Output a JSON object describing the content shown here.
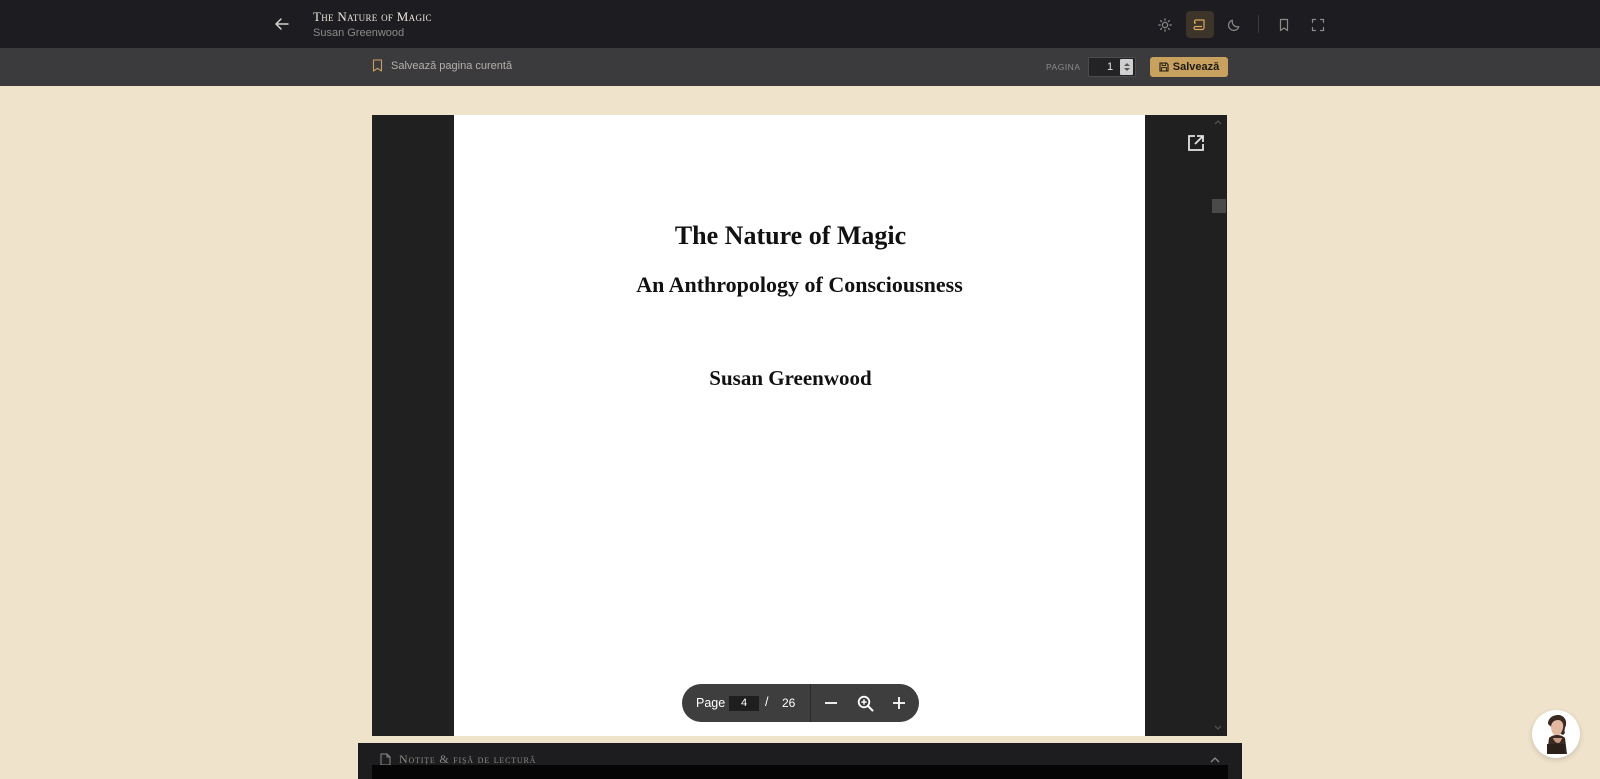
{
  "header": {
    "book_title": "The Nature of Magic",
    "book_author": "Susan Greenwood",
    "icons": [
      "back-arrow-icon",
      "sun-icon",
      "scroll-icon",
      "moon-icon",
      "bookmark-icon",
      "fullscreen-icon"
    ],
    "active_mode": "scroll"
  },
  "savebar": {
    "save_current_label": "Salvează pagina curentă",
    "page_label": "PAGINA",
    "page_value": "1",
    "save_button_label": "Salvează"
  },
  "pdf": {
    "title": "The Nature of Magic",
    "subtitle": "An Anthropology of Consciousness",
    "author": "Susan Greenwood",
    "toolbar": {
      "page_label": "Page",
      "current_page": "4",
      "separator": "/",
      "total_pages": "26"
    }
  },
  "notes": {
    "title": "Notițe & fișă de lectură"
  },
  "colors": {
    "background": "#efe3cc",
    "header": "#1c1c21",
    "savebar": "#3b3b3e",
    "accent": "#c9a15f"
  }
}
